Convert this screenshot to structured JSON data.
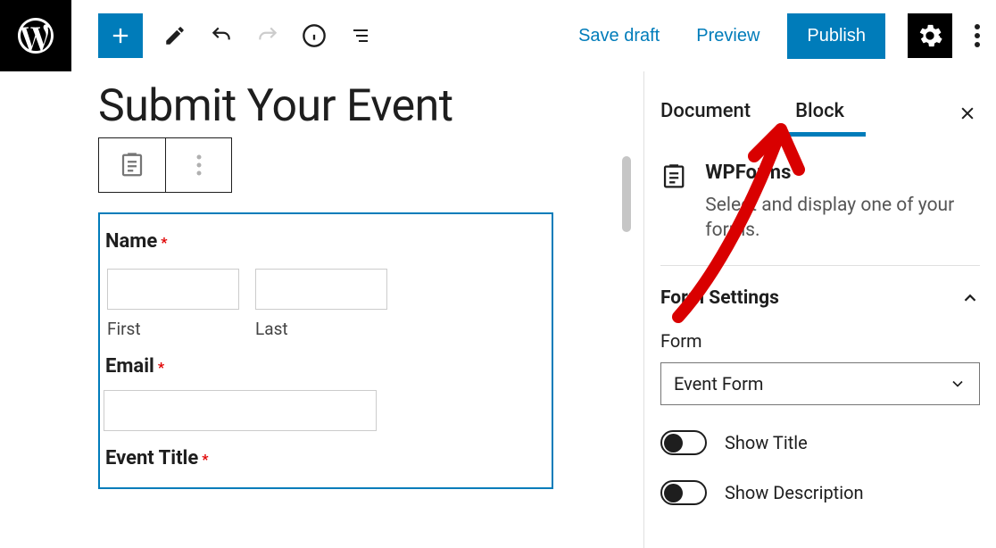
{
  "header": {
    "save_draft": "Save draft",
    "preview": "Preview",
    "publish": "Publish"
  },
  "page": {
    "title": "Submit Your Event"
  },
  "form": {
    "name_label": "Name",
    "first_label": "First",
    "last_label": "Last",
    "email_label": "Email",
    "event_title_label": "Event Title",
    "required_mark": "*"
  },
  "sidebar": {
    "tabs": {
      "document": "Document",
      "block": "Block"
    },
    "block_name": "WPForms",
    "block_desc": "Select and display one of your forms.",
    "panel_title": "Form Settings",
    "form_label": "Form",
    "form_selected": "Event Form",
    "toggle_title": "Show Title",
    "toggle_desc": "Show Description"
  }
}
